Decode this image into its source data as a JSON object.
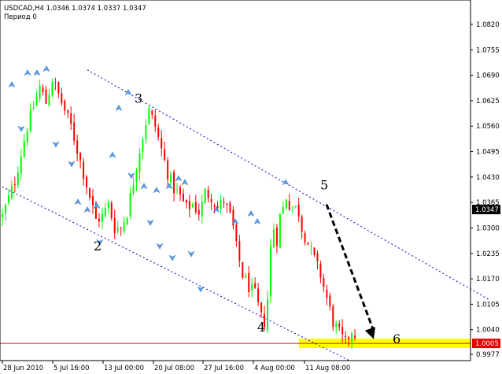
{
  "header": {
    "symbol_line": "USDCAD,H4  1.0346 1.0374 1.0337 1.0347",
    "period_line": "Период  0"
  },
  "colors": {
    "up_candle": "#00ff00",
    "down_candle": "#ff0000",
    "fractal": "#5aa0e6",
    "channel": "#0000cc",
    "support_zone": "#ffff00",
    "support_line": "#c81e1e",
    "price_tag_bg": "#000000",
    "support_tag_bg": "#e60000",
    "arrow": "#000000"
  },
  "chart_data": {
    "type": "candlestick",
    "instrument": "USDCAD",
    "timeframe": "H4",
    "ohlc_last": {
      "open": 1.0346,
      "high": 1.0374,
      "low": 1.0337,
      "close": 1.0347
    },
    "ylim": [
      0.9977,
      1.0845
    ],
    "y_ticks": [
      "1.0820",
      "1.0755",
      "1.0690",
      "1.0625",
      "1.0560",
      "1.0495",
      "1.0430",
      "1.0365",
      "1.0300",
      "1.0235",
      "1.0170",
      "1.0105",
      "1.0040",
      "0.9977"
    ],
    "x_ticks": [
      "28 Jun 2010",
      "5 Jul 16:00",
      "13 Jul 00:00",
      "20 Jul 08:00",
      "27 Jul 16:00",
      "4 Aug 00:00",
      "11 Aug 08:00"
    ],
    "current_price": {
      "value": 1.0347,
      "label": "1.0347"
    },
    "support": {
      "value": 1.0005,
      "label": "1.0005"
    },
    "close_path": [
      [
        0,
        1.033
      ],
      [
        4,
        1.042
      ],
      [
        8,
        1.056
      ],
      [
        12,
        1.066
      ],
      [
        14,
        1.062
      ],
      [
        16,
        1.068
      ],
      [
        18,
        1.064
      ],
      [
        20,
        1.06
      ],
      [
        22,
        1.056
      ],
      [
        24,
        1.05
      ],
      [
        26,
        1.044
      ],
      [
        28,
        1.038
      ],
      [
        30,
        1.032
      ],
      [
        32,
        1.033
      ],
      [
        34,
        1.036
      ],
      [
        36,
        1.03
      ],
      [
        38,
        1.03
      ],
      [
        40,
        1.034
      ],
      [
        42,
        1.042
      ],
      [
        44,
        1.05
      ],
      [
        46,
        1.057
      ],
      [
        47,
        1.06
      ],
      [
        49,
        1.056
      ],
      [
        51,
        1.05
      ],
      [
        53,
        1.044
      ],
      [
        55,
        1.04
      ],
      [
        57,
        1.038
      ],
      [
        59,
        1.035
      ],
      [
        61,
        1.036
      ],
      [
        63,
        1.034
      ],
      [
        64,
        1.036
      ],
      [
        65,
        1.039
      ],
      [
        67,
        1.038
      ],
      [
        69,
        1.035
      ],
      [
        71,
        1.037
      ],
      [
        73,
        1.033
      ],
      [
        74,
        1.03
      ],
      [
        75,
        1.025
      ],
      [
        77,
        1.018
      ],
      [
        79,
        1.015
      ],
      [
        81,
        1.013
      ],
      [
        83,
        1.007
      ],
      [
        84,
        1.006
      ],
      [
        85,
        1.012
      ],
      [
        86,
        1.025
      ],
      [
        87,
        1.03
      ],
      [
        88,
        1.027
      ],
      [
        89,
        1.033
      ],
      [
        90,
        1.035
      ],
      [
        91,
        1.038
      ],
      [
        92,
        1.036
      ],
      [
        94,
        1.035
      ],
      [
        95,
        1.034
      ],
      [
        96,
        1.03
      ],
      [
        98,
        1.026
      ],
      [
        100,
        1.022
      ],
      [
        102,
        1.018
      ],
      [
        104,
        1.012
      ],
      [
        106,
        1.006
      ],
      [
        108,
        1.003
      ],
      [
        110,
        1.0005
      ],
      [
        112,
        1.004
      ],
      [
        113,
        1.003
      ]
    ],
    "fractals": [
      {
        "i": 3,
        "dir": "up",
        "price": 1.066
      },
      {
        "i": 8,
        "dir": "up",
        "price": 1.069
      },
      {
        "i": 11,
        "dir": "up",
        "price": 1.069
      },
      {
        "i": 14,
        "dir": "up",
        "price": 1.07
      },
      {
        "i": 6,
        "dir": "down",
        "price": 1.056
      },
      {
        "i": 17,
        "dir": "down",
        "price": 1.052
      },
      {
        "i": 22,
        "dir": "down",
        "price": 1.047
      },
      {
        "i": 24,
        "dir": "up",
        "price": 1.036
      },
      {
        "i": 27,
        "dir": "up",
        "price": 1.034
      },
      {
        "i": 30,
        "dir": "up",
        "price": 1.035
      },
      {
        "i": 31,
        "dir": "down",
        "price": 1.027
      },
      {
        "i": 35,
        "dir": "up",
        "price": 1.048
      },
      {
        "i": 37,
        "dir": "up",
        "price": 1.06
      },
      {
        "i": 40,
        "dir": "up",
        "price": 1.064
      },
      {
        "i": 41,
        "dir": "down",
        "price": 1.044
      },
      {
        "i": 45,
        "dir": "up",
        "price": 1.04
      },
      {
        "i": 47,
        "dir": "down",
        "price": 1.032
      },
      {
        "i": 49,
        "dir": "up",
        "price": 1.039
      },
      {
        "i": 53,
        "dir": "up",
        "price": 1.04
      },
      {
        "i": 56,
        "dir": "up",
        "price": 1.042
      },
      {
        "i": 58,
        "dir": "up",
        "price": 1.041
      },
      {
        "i": 50,
        "dir": "down",
        "price": 1.026
      },
      {
        "i": 54,
        "dir": "down",
        "price": 1.023
      },
      {
        "i": 60,
        "dir": "down",
        "price": 1.024
      },
      {
        "i": 63,
        "dir": "down",
        "price": 1.015
      },
      {
        "i": 68,
        "dir": "up",
        "price": 1.034
      },
      {
        "i": 74,
        "dir": "up",
        "price": 1.031
      },
      {
        "i": 79,
        "dir": "up",
        "price": 1.033
      },
      {
        "i": 81,
        "dir": "up",
        "price": 1.031
      },
      {
        "i": 90,
        "dir": "up",
        "price": 1.041
      }
    ],
    "wave_labels": [
      {
        "label": "2",
        "i": 29,
        "price": 1.0243
      },
      {
        "label": "3",
        "i": 42,
        "price": 1.062
      },
      {
        "label": "4",
        "i": 81,
        "price": 1.0035
      },
      {
        "label": "5",
        "i": 101,
        "price": 1.0398
      },
      {
        "label": "6",
        "i": 124,
        "price": 1.0005
      }
    ],
    "channel_upper": {
      "from": {
        "i": 27,
        "price": 1.0704
      },
      "to": {
        "i": 155,
        "price": 1.0115
      }
    },
    "channel_lower": {
      "from": {
        "i": 0,
        "price": 1.0405
      },
      "to": {
        "i": 110,
        "price": 0.9962
      }
    },
    "forecast_arrow": {
      "from": {
        "i": 103,
        "price": 1.036
      },
      "to": {
        "i": 118,
        "price": 1.0016
      }
    }
  }
}
